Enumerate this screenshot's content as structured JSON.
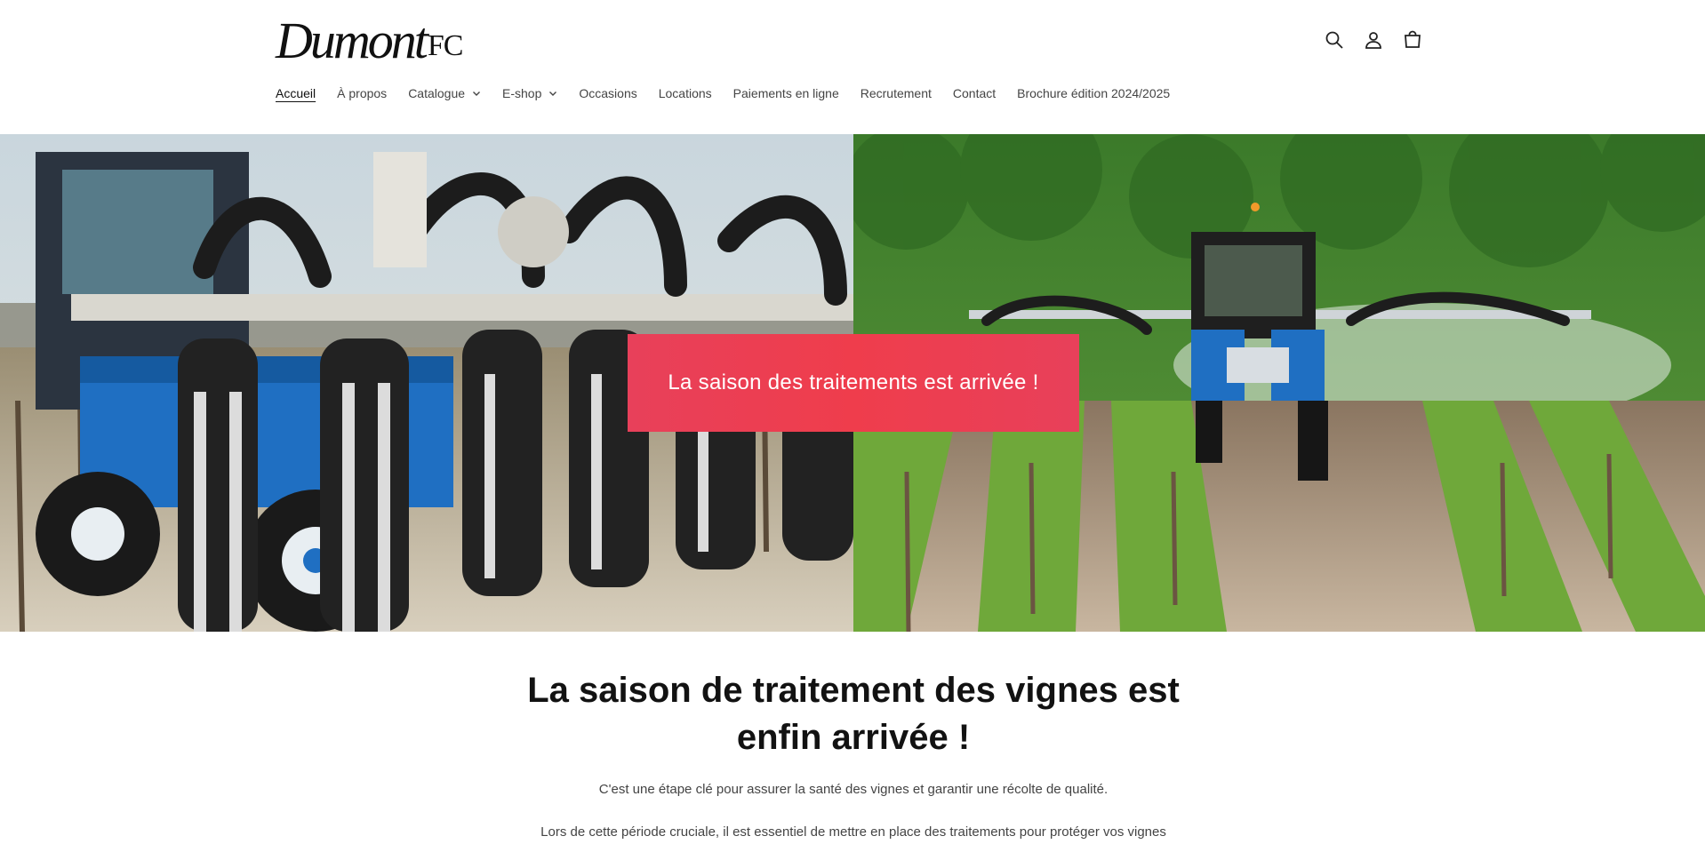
{
  "brand": {
    "name_main": "Dumont",
    "name_suffix": "FC"
  },
  "header_icons": [
    "search-icon",
    "account-icon",
    "cart-icon"
  ],
  "nav": {
    "items": [
      {
        "label": "Accueil",
        "active": true,
        "dropdown": false
      },
      {
        "label": "À propos",
        "active": false,
        "dropdown": false
      },
      {
        "label": "Catalogue",
        "active": false,
        "dropdown": true
      },
      {
        "label": "E-shop",
        "active": false,
        "dropdown": true
      },
      {
        "label": "Occasions",
        "active": false,
        "dropdown": false
      },
      {
        "label": "Locations",
        "active": false,
        "dropdown": false
      },
      {
        "label": "Paiements en ligne",
        "active": false,
        "dropdown": false
      },
      {
        "label": "Recrutement",
        "active": false,
        "dropdown": false
      },
      {
        "label": "Contact",
        "active": false,
        "dropdown": false
      },
      {
        "label": "Brochure édition 2024/2025",
        "active": false,
        "dropdown": false
      }
    ]
  },
  "hero": {
    "banner_text": "La saison des traitements est arrivée !",
    "banner_color": "#ef3d4c"
  },
  "content": {
    "headline": "La saison de traitement des vignes est enfin arrivée !",
    "intro": "C'est une étape clé pour assurer la santé des vignes et garantir une récolte de qualité.",
    "paragraph": "Lors de cette période cruciale, il est essentiel de mettre en place des traitements pour protéger vos vignes"
  },
  "colors": {
    "accent": "#ef3d4c",
    "machine_blue": "#1f6fc2",
    "text": "#121212"
  }
}
